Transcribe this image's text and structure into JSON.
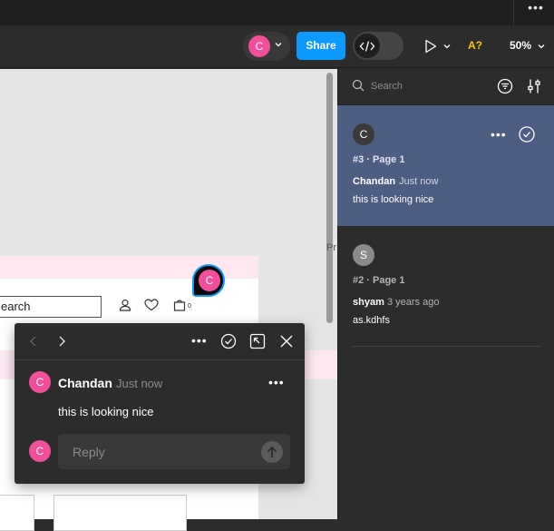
{
  "topbar": {
    "more_label": "•••"
  },
  "toolbar": {
    "avatar_initial": "C",
    "share_label": "Share",
    "accessibility_label": "A?",
    "zoom_label": "50%"
  },
  "canvas": {
    "search_text": "earch",
    "bag_count": "0",
    "pin_initial": "C",
    "peek_text": "Pr"
  },
  "popup": {
    "more_label": "•••",
    "author": "Chandan",
    "time": "Just now",
    "message": "this is looking nice",
    "avatar_initial": "C",
    "reply_avatar_initial": "C",
    "reply_placeholder": "Reply"
  },
  "panel": {
    "search_placeholder": "Search",
    "threads": [
      {
        "avatar_initial": "C",
        "meta": "#3 · Page 1",
        "author": "Chandan",
        "time": "Just now",
        "message": "this is looking nice",
        "more_label": "•••"
      },
      {
        "avatar_initial": "S",
        "meta": "#2 · Page 1",
        "author": "shyam",
        "time": "3 years ago",
        "message": "as.kdhfs"
      }
    ]
  },
  "colors": {
    "accent": "#0d99ff",
    "avatar_pink": "#f24e9a",
    "selected_thread": "#4e5d82",
    "canvas_bg": "#e5e5e5",
    "panel_bg": "#2c2c2c"
  }
}
